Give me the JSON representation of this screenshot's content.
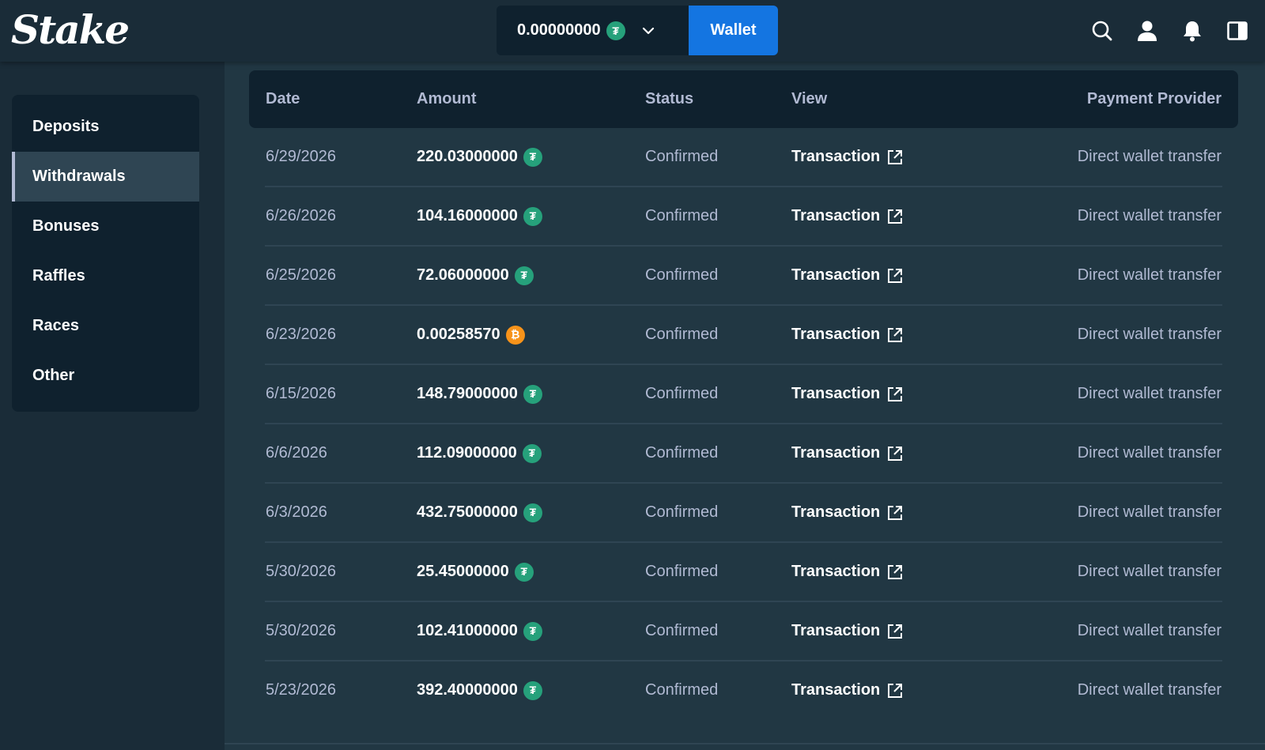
{
  "header": {
    "logo_text": "Stake",
    "balance": "0.00000000",
    "balance_currency_icon": "usdt-coin-icon",
    "wallet_label": "Wallet",
    "icons": [
      "search-icon",
      "user-icon",
      "bell-icon",
      "sidebar-toggle-icon"
    ]
  },
  "sidebar": {
    "items": [
      {
        "label": "Deposits",
        "active": false
      },
      {
        "label": "Withdrawals",
        "active": true
      },
      {
        "label": "Bonuses",
        "active": false
      },
      {
        "label": "Raffles",
        "active": false
      },
      {
        "label": "Races",
        "active": false
      },
      {
        "label": "Other",
        "active": false
      }
    ]
  },
  "table": {
    "columns": [
      "Date",
      "Amount",
      "Status",
      "View",
      "Payment Provider"
    ],
    "rows": [
      {
        "date": "6/29/2026",
        "amount": "220.03000000",
        "coin": "usdt",
        "status": "Confirmed",
        "view": "Transaction",
        "provider": "Direct wallet transfer"
      },
      {
        "date": "6/26/2026",
        "amount": "104.16000000",
        "coin": "usdt",
        "status": "Confirmed",
        "view": "Transaction",
        "provider": "Direct wallet transfer"
      },
      {
        "date": "6/25/2026",
        "amount": "72.06000000",
        "coin": "usdt",
        "status": "Confirmed",
        "view": "Transaction",
        "provider": "Direct wallet transfer"
      },
      {
        "date": "6/23/2026",
        "amount": "0.00258570",
        "coin": "btc",
        "status": "Confirmed",
        "view": "Transaction",
        "provider": "Direct wallet transfer"
      },
      {
        "date": "6/15/2026",
        "amount": "148.79000000",
        "coin": "usdt",
        "status": "Confirmed",
        "view": "Transaction",
        "provider": "Direct wallet transfer"
      },
      {
        "date": "6/6/2026",
        "amount": "112.09000000",
        "coin": "usdt",
        "status": "Confirmed",
        "view": "Transaction",
        "provider": "Direct wallet transfer"
      },
      {
        "date": "6/3/2026",
        "amount": "432.75000000",
        "coin": "usdt",
        "status": "Confirmed",
        "view": "Transaction",
        "provider": "Direct wallet transfer"
      },
      {
        "date": "5/30/2026",
        "amount": "25.45000000",
        "coin": "usdt",
        "status": "Confirmed",
        "view": "Transaction",
        "provider": "Direct wallet transfer"
      },
      {
        "date": "5/30/2026",
        "amount": "102.41000000",
        "coin": "usdt",
        "status": "Confirmed",
        "view": "Transaction",
        "provider": "Direct wallet transfer"
      },
      {
        "date": "5/23/2026",
        "amount": "392.40000000",
        "coin": "usdt",
        "status": "Confirmed",
        "view": "Transaction",
        "provider": "Direct wallet transfer"
      }
    ]
  },
  "coin_glyphs": {
    "usdt": "₮",
    "btc": "₿"
  },
  "colors": {
    "background": "#1a2c38",
    "panel": "#0f212e",
    "main": "#213743",
    "accent_blue": "#1475e1",
    "usdt_green": "#26a17b",
    "btc_orange": "#f7931a",
    "muted_text": "#b1bad3"
  }
}
